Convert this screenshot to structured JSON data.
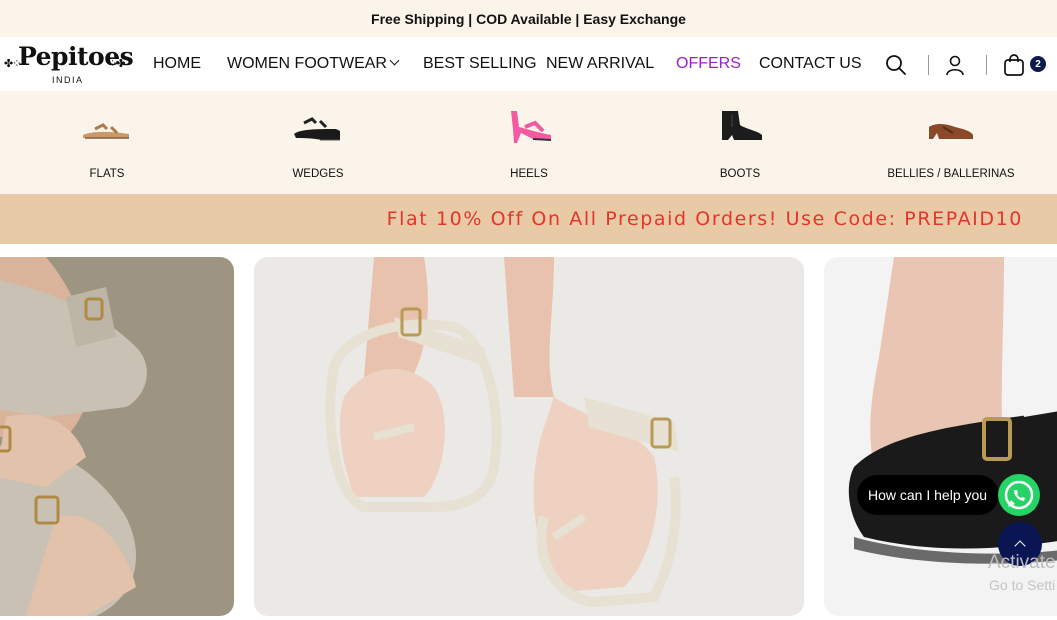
{
  "announcement": "Free Shipping | COD Available | Easy Exchange",
  "logo": {
    "brand": "Pepitoes",
    "sub": "INDIA"
  },
  "nav": {
    "home": "HOME",
    "women_footwear": "WOMEN FOOTWEAR",
    "best_selling": "BEST SELLING",
    "new_arrival": "NEW ARRIVAL",
    "offers": "OFFERS",
    "contact_us": "CONTACT US"
  },
  "cart": {
    "count": "2"
  },
  "categories": [
    {
      "label": "FLATS"
    },
    {
      "label": "WEDGES"
    },
    {
      "label": "HEELS"
    },
    {
      "label": "BOOTS"
    },
    {
      "label": "BELLIES / BALLERINAS"
    }
  ],
  "promo": "Flat 10% Off On All Prepaid Orders! Use Code: PREPAID10",
  "chat": {
    "label": "How can I help you"
  },
  "watermark": {
    "line1": "Activate",
    "line2": "Go to Setti"
  },
  "colors": {
    "cream_bg": "#fbf4ea",
    "promo_bg": "#e8cba6",
    "promo_text": "#e8332a",
    "offers_link": "#9b1fc9",
    "navy": "#0a1654",
    "whatsapp": "#25d366"
  },
  "icons": [
    "search-icon",
    "user-icon",
    "bag-icon",
    "whatsapp-icon",
    "chevron-down-icon",
    "chevron-up-icon"
  ]
}
